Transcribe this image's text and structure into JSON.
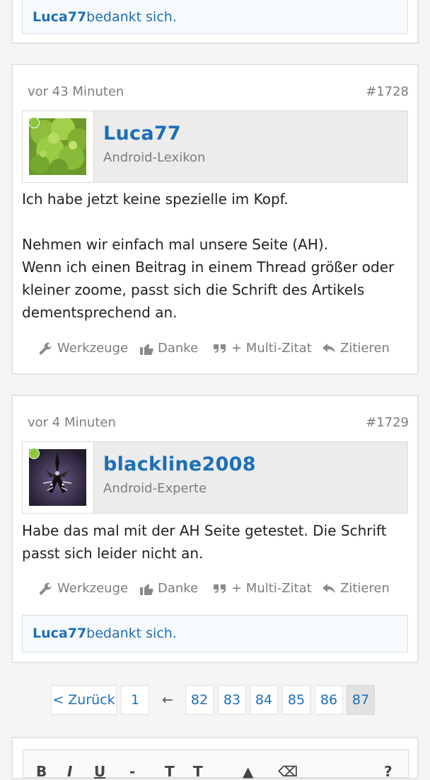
{
  "colors": {
    "link": "#1d6fb8",
    "online": "#8cc63f",
    "muted": "#7d7d7d"
  },
  "top_thanks": {
    "user": "Luca77",
    "text": " bedankt sich."
  },
  "posts": [
    {
      "time": "vor 43 Minuten",
      "number": "#1728",
      "author": "Luca77",
      "rank": "Android-Lexikon",
      "avatar_icon": "tree-avatar",
      "paragraphs": [
        "Ich habe jetzt keine spezielle im Kopf.",
        "Nehmen wir einfach mal unsere Seite (AH).\nWenn ich einen Beitrag in einem Thread größer oder kleiner zoome, passt sich die Schrift des Artikels dementsprechend an."
      ],
      "actions": {
        "tools": "Werkzeuge",
        "thanks": "Danke",
        "multiquote": "+ Multi-Zitat",
        "quote": "Zitieren"
      }
    },
    {
      "time": "vor 4 Minuten",
      "number": "#1729",
      "author": "blackline2008",
      "rank": "Android-Experte",
      "avatar_icon": "dark-figure-avatar",
      "paragraphs": [
        "Habe das mal mit der AH Seite getestet. Die Schrift passt sich leider nicht an."
      ],
      "actions": {
        "tools": "Werkzeuge",
        "thanks": "Danke",
        "multiquote": "+ Multi-Zitat",
        "quote": "Zitieren"
      },
      "thanks": {
        "user": "Luca77",
        "text": " bedankt sich."
      }
    }
  ],
  "pagination": {
    "back": "< Zurück",
    "first": "1",
    "ellipsis": "←",
    "pages": [
      "82",
      "83",
      "84",
      "85",
      "86",
      "87"
    ],
    "current": "87"
  }
}
